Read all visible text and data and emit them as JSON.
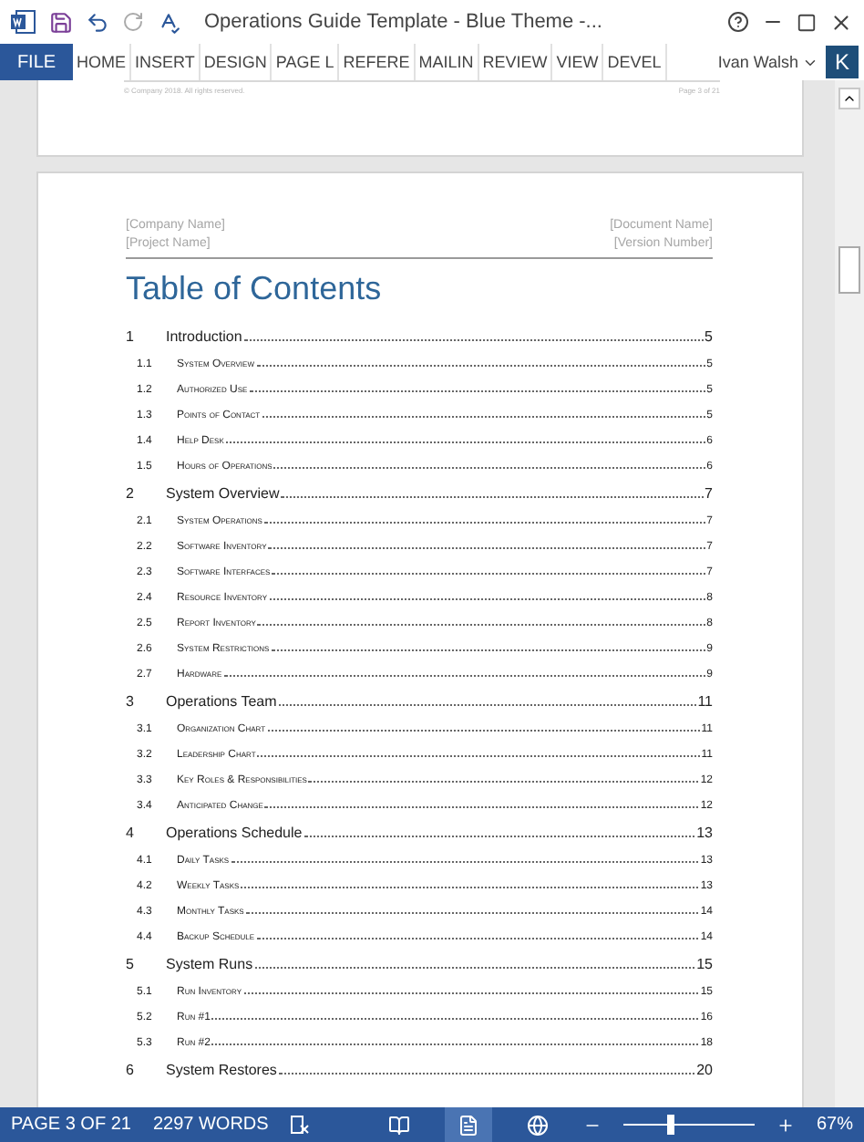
{
  "window": {
    "title": "Operations Guide Template - Blue Theme -..."
  },
  "ribbon": {
    "file_tab": "FILE",
    "tabs": [
      {
        "label": "HOME",
        "selected": false
      },
      {
        "label": "INSERT",
        "selected": false
      },
      {
        "label": "DESIGN",
        "selected": false
      },
      {
        "label": "PAGE L",
        "selected": false
      },
      {
        "label": "REFERE",
        "selected": false
      },
      {
        "label": "MAILIN",
        "selected": false
      },
      {
        "label": "REVIEW",
        "selected": false
      },
      {
        "label": "VIEW",
        "selected": false
      },
      {
        "label": "DEVEL",
        "selected": false
      }
    ],
    "user": "Ivan Walsh",
    "avatar": "K"
  },
  "previous_page": {
    "footer_left": "© Company 2018. All rights reserved.",
    "footer_right": "Page 3 of 21"
  },
  "page": {
    "header": {
      "company": "[Company Name]",
      "project": "[Project Name]",
      "document": "[Document Name]",
      "version": "[Version Number]"
    },
    "toc_title": "Table of Contents",
    "entries": [
      {
        "number": "1",
        "title": "Introduction",
        "page": "5",
        "children": [
          {
            "number": "1.1",
            "title": "System Overview",
            "page": "5"
          },
          {
            "number": "1.2",
            "title": "Authorized Use",
            "page": "5"
          },
          {
            "number": "1.3",
            "title": "Points of Contact",
            "page": "5"
          },
          {
            "number": "1.4",
            "title": "Help Desk",
            "page": "6"
          },
          {
            "number": "1.5",
            "title": "Hours of Operations",
            "page": "6"
          }
        ]
      },
      {
        "number": "2",
        "title": "System Overview",
        "page": "7",
        "children": [
          {
            "number": "2.1",
            "title": "System Operations",
            "page": "7"
          },
          {
            "number": "2.2",
            "title": "Software Inventory",
            "page": "7"
          },
          {
            "number": "2.3",
            "title": "Software Interfaces",
            "page": "7"
          },
          {
            "number": "2.4",
            "title": "Resource Inventory",
            "page": "8"
          },
          {
            "number": "2.5",
            "title": "Report Inventory",
            "page": "8"
          },
          {
            "number": "2.6",
            "title": "System Restrictions",
            "page": "9"
          },
          {
            "number": "2.7",
            "title": "Hardware",
            "page": "9"
          }
        ]
      },
      {
        "number": "3",
        "title": "Operations Team",
        "page": "11",
        "children": [
          {
            "number": "3.1",
            "title": "Organization Chart",
            "page": "11"
          },
          {
            "number": "3.2",
            "title": "Leadership Chart",
            "page": "11"
          },
          {
            "number": "3.3",
            "title": "Key Roles & Responsibilities",
            "page": "12"
          },
          {
            "number": "3.4",
            "title": "Anticipated Change",
            "page": "12"
          }
        ]
      },
      {
        "number": "4",
        "title": "Operations Schedule",
        "page": "13",
        "children": [
          {
            "number": "4.1",
            "title": "Daily Tasks",
            "page": "13"
          },
          {
            "number": "4.2",
            "title": "Weekly Tasks",
            "page": "13"
          },
          {
            "number": "4.3",
            "title": "Monthly Tasks",
            "page": "14"
          },
          {
            "number": "4.4",
            "title": "Backup Schedule",
            "page": "14"
          }
        ]
      },
      {
        "number": "5",
        "title": "System Runs",
        "page": "15",
        "children": [
          {
            "number": "5.1",
            "title": "Run Inventory",
            "page": "15"
          },
          {
            "number": "5.2",
            "title": "Run #1",
            "page": "16"
          },
          {
            "number": "5.3",
            "title": "Run #2",
            "page": "18"
          }
        ]
      },
      {
        "number": "6",
        "title": "System Restores",
        "page": "20"
      }
    ]
  },
  "status_bar": {
    "page": "PAGE 3 OF 21",
    "words": "2297 WORDS",
    "views": [
      {
        "kind": "read",
        "selected": false
      },
      {
        "kind": "print",
        "selected": true
      },
      {
        "kind": "web",
        "selected": false
      }
    ],
    "zoom": {
      "level": 0.35,
      "reading": "67%"
    }
  }
}
